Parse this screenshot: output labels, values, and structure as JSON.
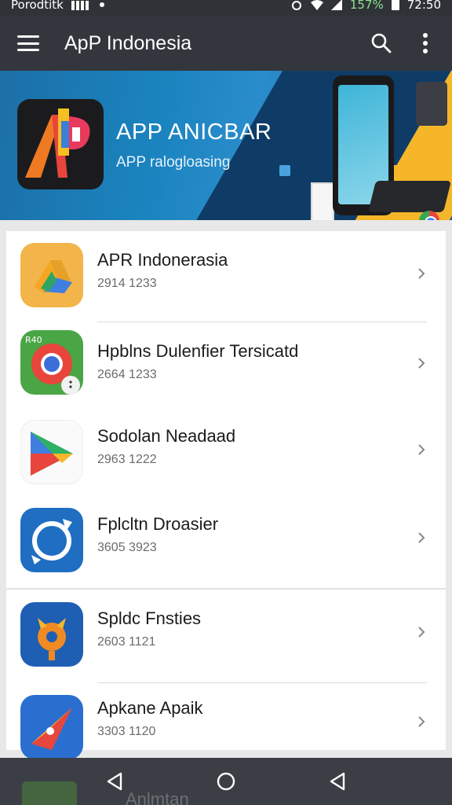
{
  "status_bar": {
    "carrier": "Porodtitk",
    "battery_percent": "157%",
    "time": "72:50",
    "icons": [
      "signal-bars-icon",
      "dot-icon",
      "alarm-icon",
      "wifi-icon",
      "cell-signal-icon",
      "battery-icon"
    ]
  },
  "app_bar": {
    "title": "ApP Indonesia",
    "icons": [
      "menu-icon",
      "search-icon",
      "more-vert-icon"
    ]
  },
  "banner": {
    "title": "APP ANICBAR",
    "subtitle": "APP ralogloasing"
  },
  "apps": [
    {
      "name": "APR Indonerasia",
      "meta": "2914 1233",
      "icon": "drive-style-icon"
    },
    {
      "name": "Hpblns Dulenfier Tersicatd",
      "meta": "2664 1233",
      "icon": "chrome-style-icon",
      "icon_label": "R40"
    },
    {
      "name": "Sodolan Neadaad",
      "meta": "2963 1222",
      "icon": "play-style-icon"
    },
    {
      "name": "Fplcltn Droasier",
      "meta": "3605 3923",
      "icon": "circle-arrow-icon"
    },
    {
      "name": "Spldc Fnsties",
      "meta": "2603 1121",
      "icon": "gear-fox-icon"
    },
    {
      "name": "Apkane Apaik",
      "meta": "3303 1120",
      "icon": "plane-icon"
    }
  ],
  "nav_bar": {
    "peek_text": "Anlmtan",
    "icons": [
      "back-icon",
      "home-icon",
      "recents-icon"
    ]
  },
  "colors": {
    "app_bar": "#33373d",
    "banner_blue": "#1a84bf",
    "banner_yellow": "#f5b62a",
    "nav_bar": "#3b3f45"
  }
}
